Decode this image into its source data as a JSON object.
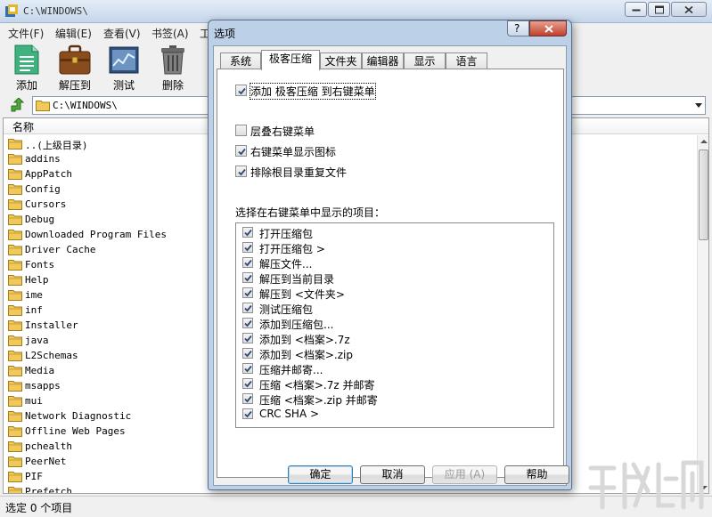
{
  "main_window": {
    "title": "C:\\WINDOWS\\",
    "menu": [
      "文件(F)",
      "编辑(E)",
      "查看(V)",
      "书签(A)",
      "工"
    ],
    "toolbar": [
      {
        "label": "添加",
        "icon": "add-archive-icon"
      },
      {
        "label": "解压到",
        "icon": "extract-briefcase-icon"
      },
      {
        "label": "测试",
        "icon": "test-chart-icon"
      },
      {
        "label": "删除",
        "icon": "trash-can-icon"
      }
    ],
    "address": "C:\\WINDOWS\\",
    "column_header": "名称",
    "files": [
      "..(上级目录)",
      "addins",
      "AppPatch",
      "Config",
      "Cursors",
      "Debug",
      "Downloaded Program Files",
      "Driver Cache",
      "Fonts",
      "Help",
      "ime",
      "inf",
      "Installer",
      "java",
      "L2Schemas",
      "Media",
      "msapps",
      "mui",
      "Network Diagnostic",
      "Offline Web Pages",
      "pchealth",
      "PeerNet",
      "PIF",
      "Prefetch"
    ],
    "status": "选定 0 个项目"
  },
  "dialog": {
    "title": "选项",
    "help_glyph": "?",
    "tabs": [
      "系统",
      "极客压缩",
      "文件夹",
      "编辑器",
      "显示",
      "语言"
    ],
    "active_tab": "极客压缩",
    "options": [
      {
        "label": "添加 极客压缩 到右键菜单",
        "checked": true
      },
      {
        "label": "层叠右键菜单",
        "checked": false
      },
      {
        "label": "右键菜单显示图标",
        "checked": true
      },
      {
        "label": "排除根目录重复文件",
        "checked": true
      }
    ],
    "items_heading": "选择在右键菜单中显示的项目：",
    "items": [
      {
        "label": "打开压缩包",
        "checked": true
      },
      {
        "label": "打开压缩包 >",
        "checked": true
      },
      {
        "label": "解压文件...",
        "checked": true
      },
      {
        "label": "解压到当前目录",
        "checked": true
      },
      {
        "label": "解压到 <文件夹>",
        "checked": true
      },
      {
        "label": "测试压缩包",
        "checked": true
      },
      {
        "label": "添加到压缩包...",
        "checked": true
      },
      {
        "label": "添加到 <档案>.7z",
        "checked": true
      },
      {
        "label": "添加到 <档案>.zip",
        "checked": true
      },
      {
        "label": "压缩并邮寄...",
        "checked": true
      },
      {
        "label": "压缩 <档案>.7z 并邮寄",
        "checked": true
      },
      {
        "label": "压缩 <档案>.zip 并邮寄",
        "checked": true
      },
      {
        "label": "CRC SHA >",
        "checked": true
      }
    ],
    "buttons": {
      "ok": "确定",
      "cancel": "取消",
      "apply": "应用 (A)",
      "help": "帮助"
    }
  },
  "colors": {
    "dialog_frame": "#bcd0e7",
    "title_gradient": "#c5d6ea",
    "check": "#2b4a77"
  }
}
